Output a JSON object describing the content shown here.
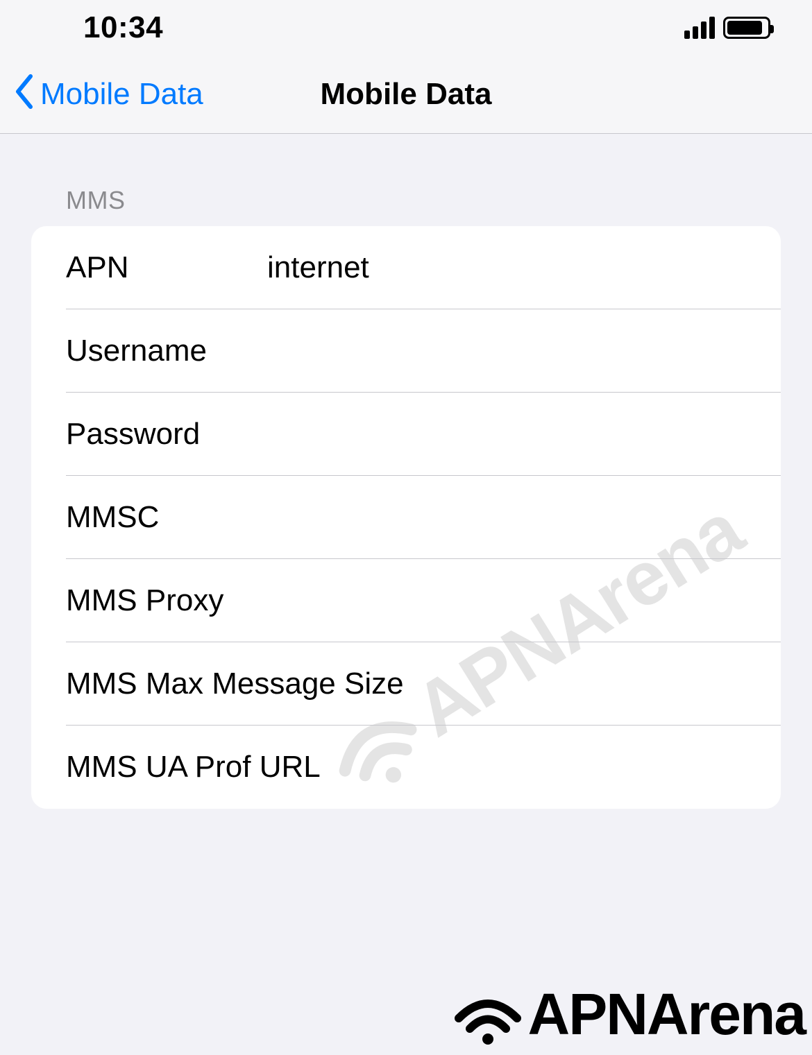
{
  "status": {
    "time": "10:34"
  },
  "nav": {
    "back_label": "Mobile Data",
    "title": "Mobile Data"
  },
  "section": {
    "header": "MMS"
  },
  "fields": {
    "apn": {
      "label": "APN",
      "value": "internet"
    },
    "username": {
      "label": "Username",
      "value": ""
    },
    "password": {
      "label": "Password",
      "value": ""
    },
    "mmsc": {
      "label": "MMSC",
      "value": ""
    },
    "mms_proxy": {
      "label": "MMS Proxy",
      "value": ""
    },
    "mms_max_size": {
      "label": "MMS Max Message Size",
      "value": ""
    },
    "mms_ua_prof": {
      "label": "MMS UA Prof URL",
      "value": ""
    }
  },
  "brand": {
    "name": "APNArena"
  }
}
